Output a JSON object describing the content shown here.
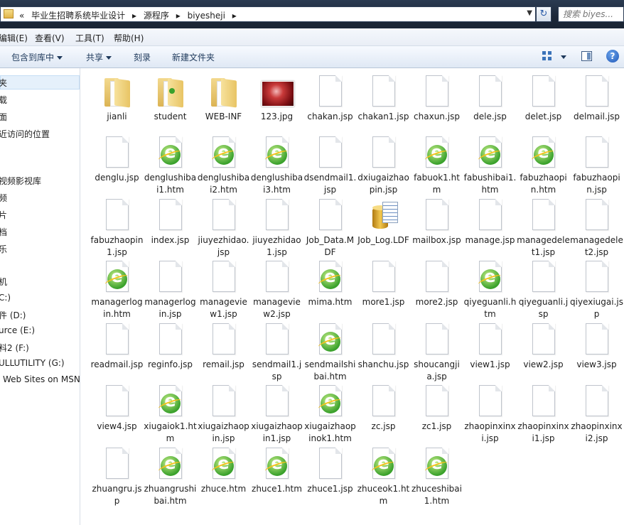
{
  "address": {
    "crumbs": [
      "«",
      "毕业生招聘系统毕业设计",
      "▸",
      "源程序",
      "▸",
      "biyesheji",
      "▸"
    ],
    "search_placeholder": "搜索 biyes..."
  },
  "menu": [
    "编辑(E)",
    "查看(V)",
    "工具(T)",
    "帮助(H)"
  ],
  "toolbar": {
    "include_library": "包含到库中",
    "share": "共享",
    "burn": "刻录",
    "new_folder": "新建文件夹"
  },
  "nav": [
    "夹",
    "载",
    "面",
    "近访问的位置",
    "",
    "视频影视库",
    "频",
    "片",
    "档",
    "乐",
    "",
    "机",
    "C:)",
    "件 (D:)",
    "urce (E:)",
    "料2 (F:)",
    "ULLUTILITY (G:)",
    "Web Sites on MSN"
  ],
  "files": [
    {
      "name": "jianli",
      "icon": "folder"
    },
    {
      "name": "student",
      "icon": "folder-ie"
    },
    {
      "name": "WEB-INF",
      "icon": "folder"
    },
    {
      "name": "123.jpg",
      "icon": "image"
    },
    {
      "name": "chakan.jsp",
      "icon": "page"
    },
    {
      "name": "chakan1.jsp",
      "icon": "page"
    },
    {
      "name": "chaxun.jsp",
      "icon": "page"
    },
    {
      "name": "dele.jsp",
      "icon": "page"
    },
    {
      "name": "delet.jsp",
      "icon": "page"
    },
    {
      "name": "delmail.jsp",
      "icon": "page"
    },
    {
      "name": "denglu.jsp",
      "icon": "page"
    },
    {
      "name": "denglushibai1.htm",
      "icon": "ie"
    },
    {
      "name": "denglushibai2.htm",
      "icon": "ie"
    },
    {
      "name": "denglushibai3.htm",
      "icon": "ie"
    },
    {
      "name": "dsendmail1.jsp",
      "icon": "page"
    },
    {
      "name": "dxiugaizhaopin.jsp",
      "icon": "page"
    },
    {
      "name": "fabuok1.htm",
      "icon": "ie"
    },
    {
      "name": "fabushibai1.htm",
      "icon": "ie"
    },
    {
      "name": "fabuzhaopin.htm",
      "icon": "ie"
    },
    {
      "name": "fabuzhaopin.jsp",
      "icon": "page"
    },
    {
      "name": "fabuzhaopin1.jsp",
      "icon": "page"
    },
    {
      "name": "index.jsp",
      "icon": "page"
    },
    {
      "name": "jiuyezhidao.jsp",
      "icon": "page"
    },
    {
      "name": "jiuyezhidao1.jsp",
      "icon": "page"
    },
    {
      "name": "Job_Data.MDF",
      "icon": "page"
    },
    {
      "name": "Job_Log.LDF",
      "icon": "db"
    },
    {
      "name": "mailbox.jsp",
      "icon": "page"
    },
    {
      "name": "manage.jsp",
      "icon": "page"
    },
    {
      "name": "managedelet1.jsp",
      "icon": "page"
    },
    {
      "name": "managedelet2.jsp",
      "icon": "page"
    },
    {
      "name": "managerlogin.htm",
      "icon": "ie"
    },
    {
      "name": "managerlogin.jsp",
      "icon": "page"
    },
    {
      "name": "manageview1.jsp",
      "icon": "page"
    },
    {
      "name": "manageview2.jsp",
      "icon": "page"
    },
    {
      "name": "mima.htm",
      "icon": "ie"
    },
    {
      "name": "more1.jsp",
      "icon": "page"
    },
    {
      "name": "more2.jsp",
      "icon": "page"
    },
    {
      "name": "qiyeguanli.htm",
      "icon": "ie"
    },
    {
      "name": "qiyeguanli.jsp",
      "icon": "page"
    },
    {
      "name": "qiyexiugai.jsp",
      "icon": "page"
    },
    {
      "name": "readmail.jsp",
      "icon": "page"
    },
    {
      "name": "reginfo.jsp",
      "icon": "page"
    },
    {
      "name": "remail.jsp",
      "icon": "page"
    },
    {
      "name": "sendmail1.jsp",
      "icon": "page"
    },
    {
      "name": "sendmailshibai.htm",
      "icon": "ie"
    },
    {
      "name": "shanchu.jsp",
      "icon": "page"
    },
    {
      "name": "shoucangjia.jsp",
      "icon": "page"
    },
    {
      "name": "view1.jsp",
      "icon": "page"
    },
    {
      "name": "view2.jsp",
      "icon": "page"
    },
    {
      "name": "view3.jsp",
      "icon": "page"
    },
    {
      "name": "view4.jsp",
      "icon": "page"
    },
    {
      "name": "xiugaiok1.htm",
      "icon": "ie"
    },
    {
      "name": "xiugaizhaopin.jsp",
      "icon": "page"
    },
    {
      "name": "xiugaizhaopin1.jsp",
      "icon": "page"
    },
    {
      "name": "xiugaizhaopinok1.htm",
      "icon": "ie"
    },
    {
      "name": "zc.jsp",
      "icon": "page"
    },
    {
      "name": "zc1.jsp",
      "icon": "page"
    },
    {
      "name": "zhaopinxinxi.jsp",
      "icon": "page"
    },
    {
      "name": "zhaopinxinxi1.jsp",
      "icon": "page"
    },
    {
      "name": "zhaopinxinxi2.jsp",
      "icon": "page"
    },
    {
      "name": "zhuangru.jsp",
      "icon": "page"
    },
    {
      "name": "zhuangrushibai.htm",
      "icon": "ie"
    },
    {
      "name": "zhuce.htm",
      "icon": "ie"
    },
    {
      "name": "zhuce1.htm",
      "icon": "ie"
    },
    {
      "name": "zhuce1.jsp",
      "icon": "page"
    },
    {
      "name": "zhuceok1.htm",
      "icon": "ie"
    },
    {
      "name": "zhuceshibai1.htm",
      "icon": "ie"
    }
  ]
}
